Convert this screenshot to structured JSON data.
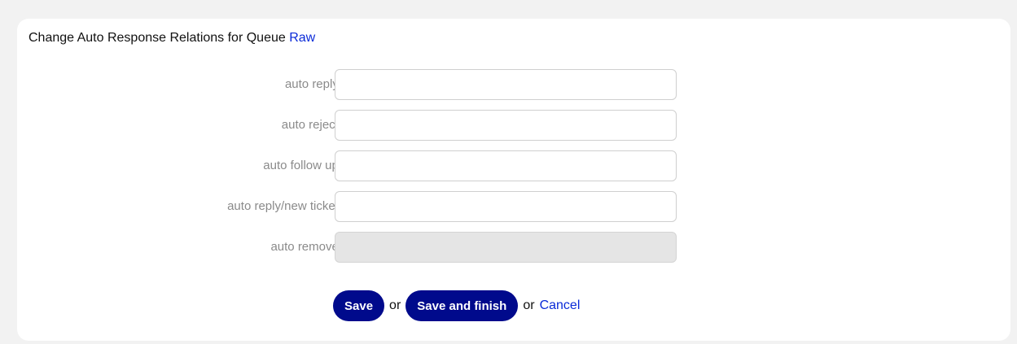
{
  "header": {
    "title": "Change Auto Response Relations for Queue",
    "queue_name": "Raw"
  },
  "form": {
    "fields": [
      {
        "label": "auto reply:",
        "value": "",
        "disabled": false
      },
      {
        "label": "auto reject:",
        "value": "",
        "disabled": false
      },
      {
        "label": "auto follow up:",
        "value": "",
        "disabled": false
      },
      {
        "label": "auto reply/new ticket:",
        "value": "",
        "disabled": false
      },
      {
        "label": "auto remove:",
        "value": "",
        "disabled": true
      }
    ]
  },
  "actions": {
    "save_label": "Save",
    "or_1": "or",
    "save_finish_label": "Save and finish",
    "or_2": "or",
    "cancel_label": "Cancel"
  },
  "colors": {
    "page_bg": "#f2f2f2",
    "card_bg": "#ffffff",
    "button_bg": "#000a8c",
    "link": "#0a2ad8",
    "label": "#8a8a8a",
    "disabled_input": "#e5e5e5"
  }
}
